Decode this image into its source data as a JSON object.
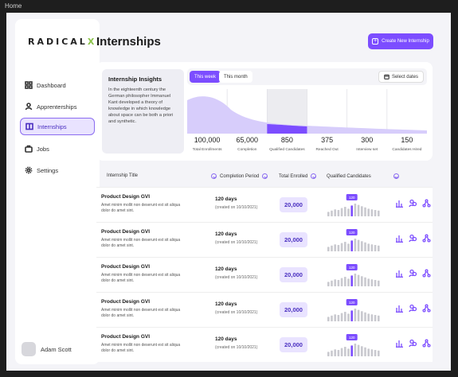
{
  "frame_label": "Home",
  "brand": {
    "logo_text": "RADICAL",
    "logo_accent": "X"
  },
  "sidebar": {
    "items": [
      {
        "label": "Dashboard",
        "icon": "grid-icon"
      },
      {
        "label": "Apprenterships",
        "icon": "users-icon"
      },
      {
        "label": "Internships",
        "icon": "book-icon",
        "active": true
      },
      {
        "label": "Jobs",
        "icon": "briefcase-icon"
      },
      {
        "label": "Settings",
        "icon": "gear-icon"
      }
    ],
    "user": {
      "name": "Adam Scott"
    }
  },
  "header": {
    "title": "Internships",
    "create_label": "Create New Internship"
  },
  "insights": {
    "title": "Internship Insights",
    "text": "In the eighteenth century the German philosopher Immanuel Kant developed a theory of knowledge in which knowledge about space can be both a priori and synthetic.",
    "tabs": {
      "active": "This week",
      "inactive": "This month"
    },
    "select_dates": "Select dates"
  },
  "chart_data": {
    "type": "area",
    "categories": [
      "Total Enrollments",
      "Completion",
      "Qualified Candidates",
      "Reached Out",
      "Interview set",
      "Candidates Hired"
    ],
    "values": [
      "100,000",
      "65,000",
      "850",
      "375",
      "300",
      "150"
    ],
    "highlight_index": 2
  },
  "table": {
    "headers": {
      "title": "Internship Title",
      "period": "Completion Period",
      "enrolled": "Total Enrolled",
      "qualified": "Qualified Candidates"
    },
    "rows": [
      {
        "title": "Product Design GVI",
        "desc": "Amet minim mollit non deserunt est sit aliqua dolor do amet sint.",
        "days": "120 days",
        "created": "(created on 10/10/2021)",
        "enrolled": "20,000",
        "badge": "120"
      },
      {
        "title": "Product Design GVI",
        "desc": "Amet minim mollit non deserunt est sit aliqua dolor do amet sint.",
        "days": "120 days",
        "created": "(created on 10/10/2021)",
        "enrolled": "20,000",
        "badge": "120"
      },
      {
        "title": "Product Design GVI",
        "desc": "Amet minim mollit non deserunt est sit aliqua dolor do amet sint.",
        "days": "120 days",
        "created": "(created on 10/10/2021)",
        "enrolled": "20,000",
        "badge": "120"
      },
      {
        "title": "Product Design GVI",
        "desc": "Amet minim mollit non deserunt est sit aliqua dolor do amet sint.",
        "days": "120 days",
        "created": "(created on 10/10/2021)",
        "enrolled": "20,000",
        "badge": "120"
      },
      {
        "title": "Product Design GVI",
        "desc": "Amet minim mollit non deserunt est sit aliqua dolor do amet sint.",
        "days": "120 days",
        "created": "(created on 10/10/2021)",
        "enrolled": "20,000",
        "badge": "120"
      }
    ]
  },
  "spark_levels": [
    0.35,
    0.45,
    0.55,
    0.5,
    0.65,
    0.75,
    0.6,
    0.85,
    1.0,
    0.9,
    0.8,
    0.7,
    0.6,
    0.55,
    0.5,
    0.45
  ],
  "spark_highlight": 7,
  "colors": {
    "accent": "#7c4dff",
    "accent_light": "#e9e3ff",
    "bar": "#c9c9cf"
  },
  "row_actions": [
    "bar-chart-icon",
    "people-icon",
    "share-icon"
  ]
}
